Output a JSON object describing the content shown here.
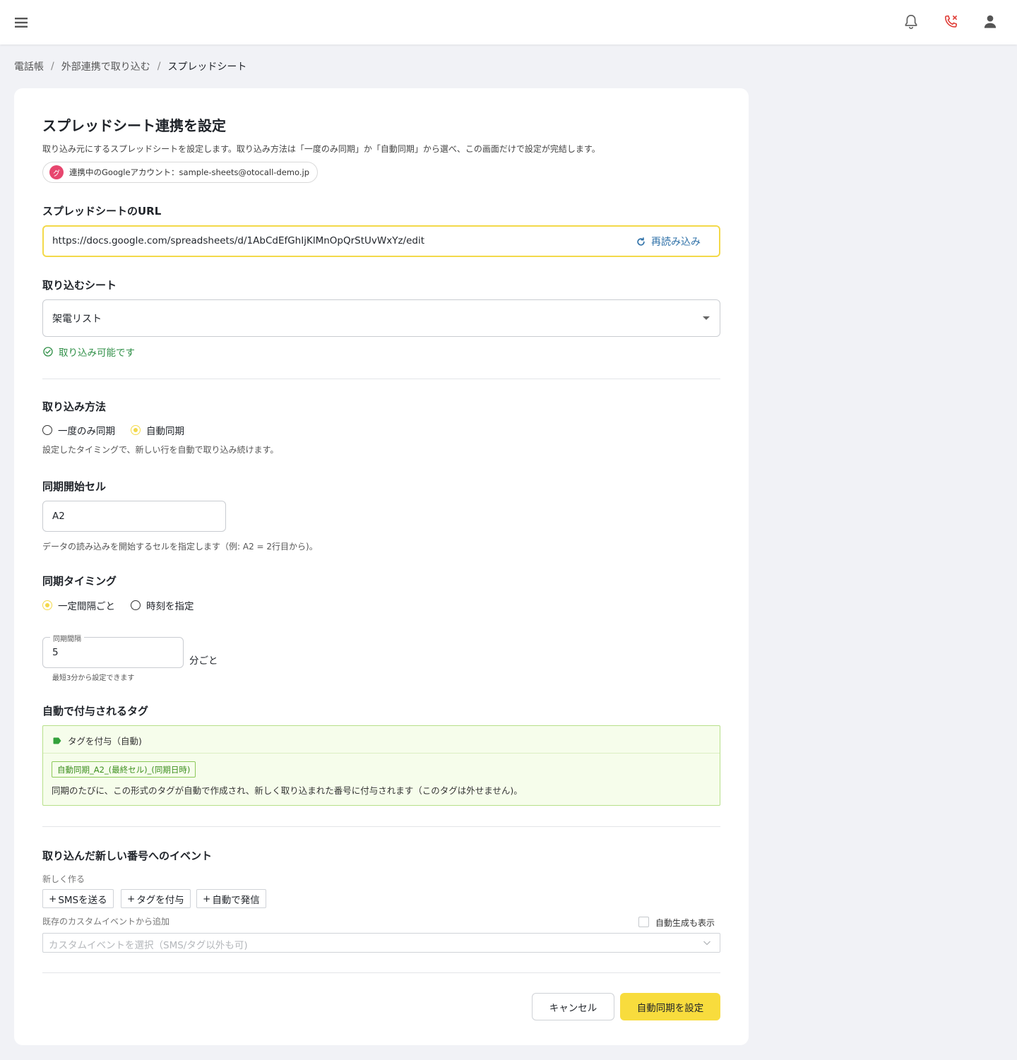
{
  "header": {
    "icons": [
      "menu-icon",
      "bell-icon",
      "phone-missed-icon",
      "user-icon"
    ],
    "accent_color": "#f8dc3d",
    "missed_call_color": "#e0403a"
  },
  "breadcrumb": {
    "items": [
      "電話帳",
      "外部連携で取り込む",
      "スプレッドシート"
    ],
    "separator": "/"
  },
  "page": {
    "title": "スプレッドシート連携を設定",
    "description": "取り込み元にするスプレッドシートを設定します。取り込み方法は「一度のみ同期」か「自動同期」から選べ、この画面だけで設定が完結します。",
    "account_avatar": "グ",
    "account_text": "連携中のGoogleアカウント：sample-sheets@otocall-demo.jp"
  },
  "url_section": {
    "label": "スプレッドシートのURL",
    "value": "https://docs.google.com/spreadsheets/d/1AbCdEfGhIjKlMnOpQrStUvWxYz/edit",
    "reload_label": "再読み込み"
  },
  "sheet_section": {
    "label": "取り込むシート",
    "selected": "架電リスト",
    "status": "取り込み可能です",
    "status_color": "#2f8f47"
  },
  "method_section": {
    "label": "取り込み方法",
    "options": [
      {
        "label": "一度のみ同期",
        "checked": false
      },
      {
        "label": "自動同期",
        "checked": true
      }
    ],
    "help": "設定したタイミングで、新しい行を自動で取り込み続けます。"
  },
  "start_cell": {
    "label": "同期開始セル",
    "value": "A2",
    "help": "データの読み込みを開始するセルを指定します（例: A2 = 2行目から)。"
  },
  "timing": {
    "label": "同期タイミング",
    "options": [
      {
        "label": "一定間隔ごと",
        "checked": true
      },
      {
        "label": "時刻を指定",
        "checked": false
      }
    ],
    "interval_label": "同期間隔",
    "interval_value": "5",
    "interval_unit": "分ごと",
    "interval_help": "最短3分から設定できます"
  },
  "auto_tag": {
    "label": "自動で付与されるタグ",
    "panel_title": "タグを付与（自動)",
    "tag": "自動同期_A2_(最終セル)_(同期日時)",
    "note": "同期のたびに、この形式のタグが自動で作成され、新しく取り込まれた番号に付与されます（このタグは外せません)。",
    "panel_bg": "#f6fdeb",
    "panel_border": "#b7e08a"
  },
  "events": {
    "label": "取り込んだ新しい番号へのイベント",
    "create_label": "新しく作る",
    "create_buttons": [
      "SMSを送る",
      "タグを付与",
      "自動で発信"
    ],
    "existing_label": "既存のカスタムイベントから追加",
    "show_auto_label": "自動生成も表示",
    "select_placeholder": "カスタムイベントを選択（SMS/タグ以外も可)"
  },
  "footer": {
    "cancel_label": "キャンセル",
    "submit_label": "自動同期を設定"
  }
}
